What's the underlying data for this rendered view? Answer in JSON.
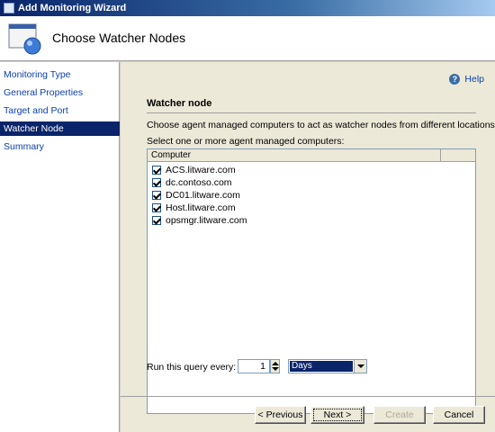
{
  "window": {
    "title": "Add Monitoring Wizard"
  },
  "header": {
    "title": "Choose Watcher Nodes",
    "icon": "wizard-window-icon"
  },
  "nav": {
    "items": [
      {
        "label": "Monitoring Type",
        "active": false
      },
      {
        "label": "General Properties",
        "active": false
      },
      {
        "label": "Target and Port",
        "active": false
      },
      {
        "label": "Watcher Node",
        "active": true
      },
      {
        "label": "Summary",
        "active": false
      }
    ]
  },
  "help": {
    "label": "Help",
    "icon": "help-icon"
  },
  "section": {
    "title": "Watcher node",
    "description": "Choose agent managed computers to act as watcher nodes from different locations.",
    "select_label": "Select one or more agent managed computers:"
  },
  "computers": {
    "column_header": "Computer",
    "rows": [
      {
        "name": "ACS.litware.com",
        "checked": true
      },
      {
        "name": "dc.contoso.com",
        "checked": true
      },
      {
        "name": "DC01.litware.com",
        "checked": true
      },
      {
        "name": "Host.litware.com",
        "checked": true
      },
      {
        "name": "opsmgr.litware.com",
        "checked": true
      }
    ]
  },
  "query": {
    "label": "Run this query every:",
    "interval_value": "1",
    "unit_selected": "Days"
  },
  "buttons": {
    "previous": "< Previous",
    "next": "Next >",
    "create": "Create",
    "cancel": "Cancel"
  },
  "colors": {
    "selection": "#0a246a",
    "link": "#0b3fae",
    "panel": "#ece9d8"
  }
}
